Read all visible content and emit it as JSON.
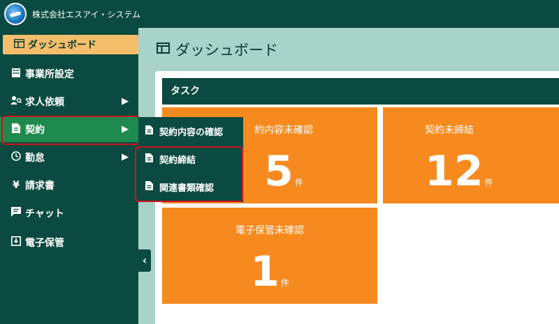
{
  "header": {
    "company_name": "株式会社エスアイ・システム"
  },
  "sidebar": {
    "items": [
      {
        "label": "ダッシュボード",
        "icon": "dashboard-icon"
      },
      {
        "label": "事業所設定",
        "icon": "building-icon"
      },
      {
        "label": "求人依頼",
        "icon": "user-search-icon"
      },
      {
        "label": "契約",
        "icon": "document-icon"
      },
      {
        "label": "勤怠",
        "icon": "clock-icon"
      },
      {
        "label": "請求書",
        "icon": "yen-icon"
      },
      {
        "label": "チャット",
        "icon": "chat-icon"
      },
      {
        "label": "電子保管",
        "icon": "archive-icon"
      }
    ],
    "arrow": "▶",
    "collapse": "‹"
  },
  "submenu": {
    "items": [
      {
        "label": "契約内容の確認"
      },
      {
        "label": "契約締結"
      },
      {
        "label": "関連書類確認"
      }
    ]
  },
  "main": {
    "title": "ダッシュボード",
    "task_panel": {
      "heading": "タスク",
      "cards": [
        {
          "label": "約内容未確認",
          "count": "5",
          "unit": "件"
        },
        {
          "label": "契約未締結",
          "count": "12",
          "unit": "件"
        },
        {
          "label": "電子保管未確認",
          "count": "1",
          "unit": "件"
        }
      ]
    }
  },
  "colors": {
    "sidebar": "#0b4a40",
    "active": "#f6be6a",
    "current": "#1e8a4e",
    "card": "#f78a1f",
    "highlight": "#d0121e",
    "background": "#a9d2c8"
  }
}
